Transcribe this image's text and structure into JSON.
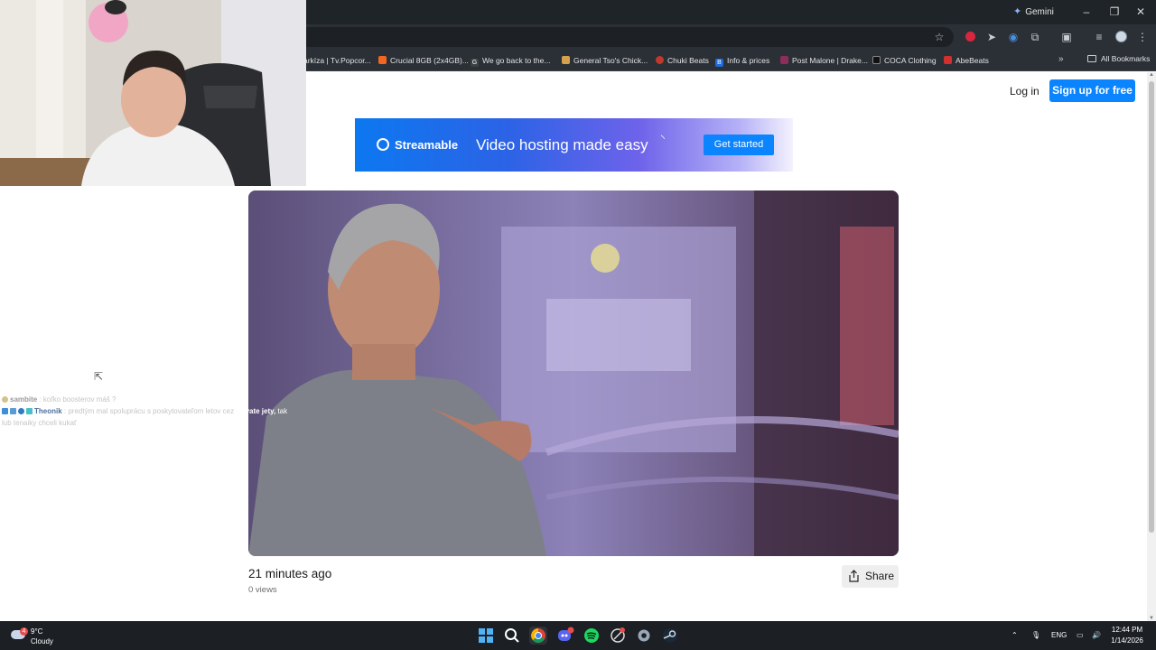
{
  "browser": {
    "gemini_label": "Gemini",
    "bookmarks": [
      {
        "label": "arkíza | Tv.Popcor...",
        "color": "#2b3036"
      },
      {
        "label": "Crucial 8GB (2x4GB)...",
        "color": "#f26522"
      },
      {
        "label": "We go back to the...",
        "color": "#3c4043"
      },
      {
        "label": "General Tso's Chick...",
        "color": "#d4a24c"
      },
      {
        "label": "Chuki Beats",
        "color": "#c0392b"
      },
      {
        "label": "Info & prices",
        "color": "#1e6bd6"
      },
      {
        "label": "Post Malone | Drake...",
        "color": "#8e2d5a"
      },
      {
        "label": "COCA Clothing",
        "color": "#111111"
      },
      {
        "label": "AbeBeats",
        "color": "#d32f2f"
      }
    ],
    "all_bookmarks_label": "All Bookmarks"
  },
  "header": {
    "login_label": "Log in",
    "signup_label": "Sign up for free"
  },
  "banner": {
    "brand": "Streamable",
    "tagline": "Video hosting made easy",
    "cta": "Get started"
  },
  "video_meta": {
    "posted": "21 minutes ago",
    "views": "0 views",
    "share_label": "Share"
  },
  "chat": {
    "msg1_user": "sambite",
    "msg1_text": ": koľko boosterov máš ?",
    "msg2_user": "Theonik",
    "msg2_text": ": predtým mal spoluprácu s poskytovateľom letov cez",
    "msg2_highlight": "private jety,",
    "msg2_tail": "tak",
    "msg2_line2": "lub tenaiky chceli kukať"
  },
  "taskbar": {
    "temp": "9°C",
    "condition": "Cloudy",
    "weather_alert": "4",
    "lang": "ENG",
    "time": "12:44 PM",
    "date": "1/14/2026"
  },
  "colors": {
    "accent": "#0a84ff",
    "chrome_dark": "#1f2428",
    "toolbar": "#2b3036"
  },
  "icons": {
    "bookmark_star": "star-icon",
    "share": "share-icon",
    "start": "windows-start-icon",
    "search": "search-icon"
  }
}
